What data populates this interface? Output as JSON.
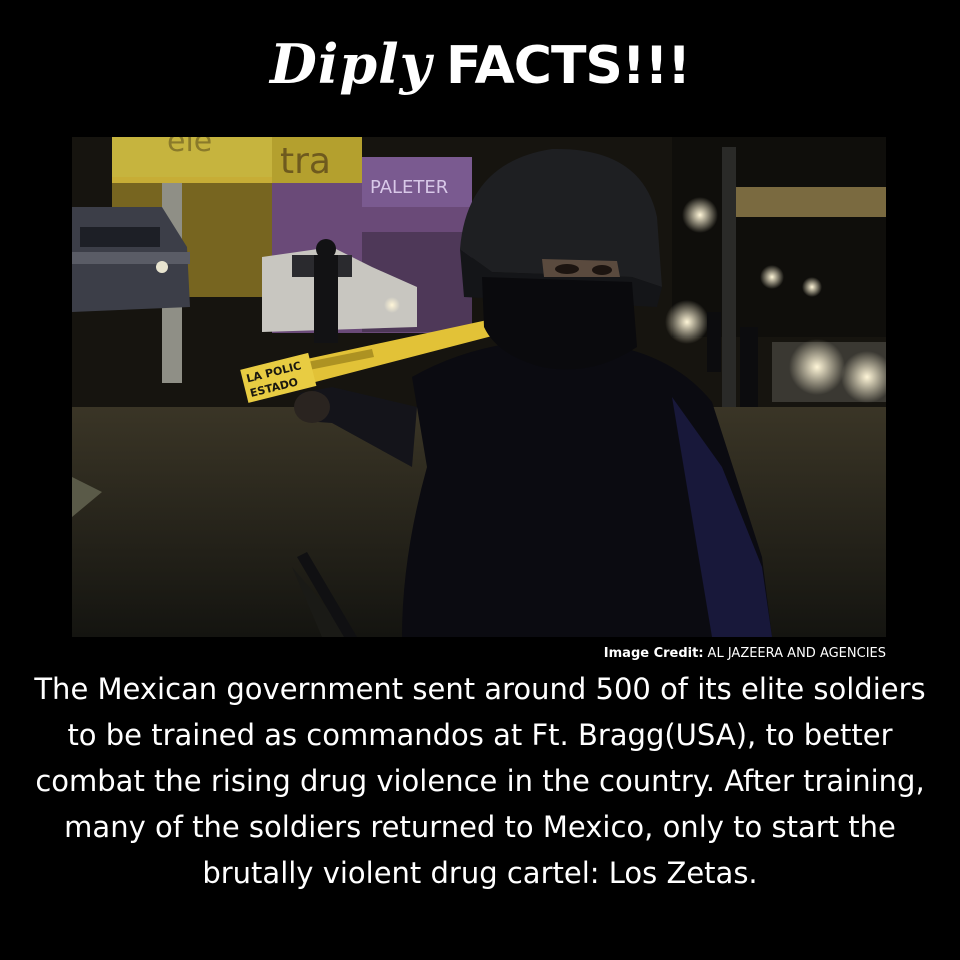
{
  "logo": {
    "script_text": "Diply",
    "bold_text": "FACTS!!!"
  },
  "photo": {
    "sign_top_text": "tra",
    "sign_top_fragment": "ele",
    "shop_sign_text": "PALETER",
    "tape_line_1": "LA POLIC",
    "tape_line_2": "ESTADO"
  },
  "credit": {
    "label": "Image Credit:",
    "source": "AL JAZEERA AND AGENCIES"
  },
  "fact": {
    "text": "The Mexican government sent around 500 of its elite soldiers to be trained as commandos at Ft. Bragg(USA), to better combat the rising drug violence in the country. After training, many of the soldiers returned to Mexico, only to start the brutally violent drug cartel: Los Zetas."
  }
}
